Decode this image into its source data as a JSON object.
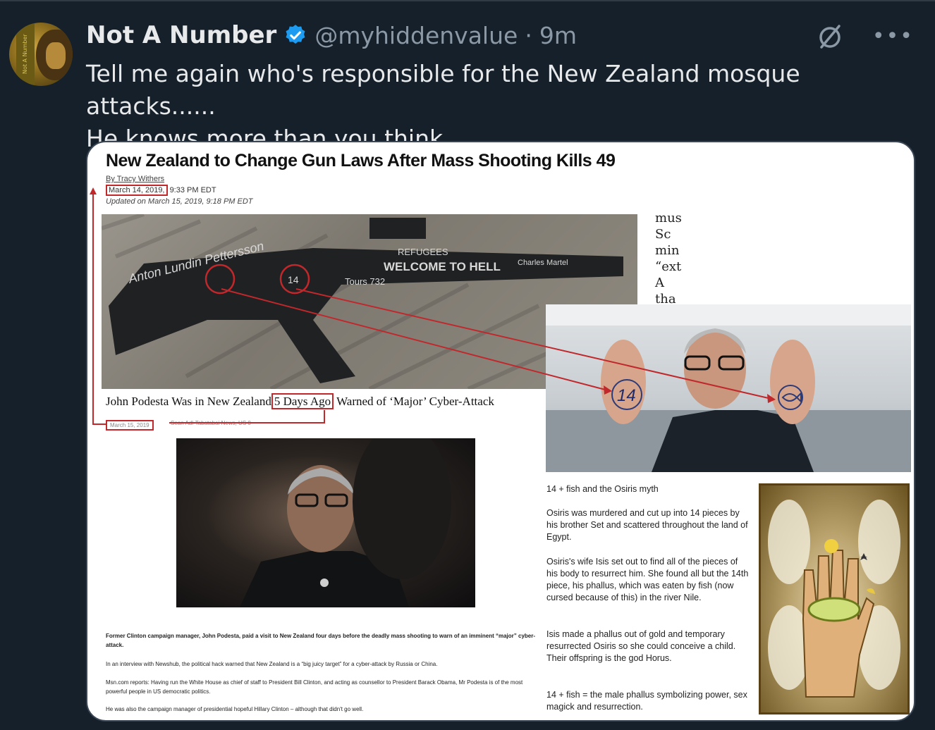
{
  "tweet": {
    "display_name": "Not A Number",
    "handle": "@myhiddenvalue",
    "separator": "·",
    "time": "9m",
    "text_line1": "Tell me again who's responsible for the New Zealand mosque attacks......",
    "text_line2": "He knows more than you think"
  },
  "avatar": {
    "label": "Not A Number"
  },
  "icons": {
    "verified": "verified-badge-icon",
    "grok": "grok-icon",
    "more": "more-icon"
  },
  "colors": {
    "background": "#15202b",
    "text": "#e7e9ea",
    "muted": "#8b98a5",
    "verified": "#1d9bf0",
    "annotation_red": "#c0282c"
  },
  "media": {
    "headline": "New Zealand to Change Gun Laws After Mass Shooting Kills 49",
    "byline": "By Tracy Withers",
    "pub_date": "March 14, 2019,",
    "pub_time": "9:33 PM EDT",
    "updated": "Updated on March 15, 2019, 9:18 PM EDT",
    "gun_texts": [
      "Anton Lundin Pettersson",
      "Charles Martel",
      "WELCOME TO HELL",
      "REFUGEES",
      "14",
      "Tours 732"
    ],
    "serif_fragment": [
      "mus",
      "Sc",
      "min",
      "“ext",
      "A",
      "tha"
    ],
    "palm_left": "14",
    "article2_pre": "John Podesta Was in New Zealand",
    "article2_box": "5 Days Ago",
    "article2_post": "Warned of ‘Major’ Cyber-Attack",
    "article2_date": "March 15, 2019",
    "article2_meta": "Sean Adl-Tabatabai   News, US   0",
    "caption": "Former Clinton campaign manager, John Podesta, paid a visit to New Zealand four days before the deadly mass shooting to warn of an imminent “major” cyber-attack.",
    "para1": "In an interview with Newshub, the political hack warned that New Zealand is a “big juicy target” for a cyber-attack by Russia or China.",
    "para2": "Msn.com reports: Having run the White House as chief of staff to President Bill Clinton, and acting as counsellor to President Barack Obama, Mr Podesta is of the most powerful people in US democratic politics.",
    "para3": "He was also the campaign manager of presidential hopeful Hillary Clinton – although that didn't go well.",
    "myth_title": "14 + fish and the Osiris myth",
    "myth_p1": "Osiris was murdered and cut up into 14 pieces by his brother Set and scattered throughout the land of Egypt.",
    "myth_p2": "Osiris's wife Isis set out to find all of the pieces of his body to resurrect him. She found all but the 14th piece, his phallus, which was eaten by fish (now cursed because of this) in the river Nile.",
    "myth_p3": "Isis made a phallus out of gold and temporary resurrected Osiris so she could conceive a child. Their offspring is the god Horus.",
    "myth_p4": "14 + fish = the male phallus symbolizing power, sex magick and resurrection."
  }
}
